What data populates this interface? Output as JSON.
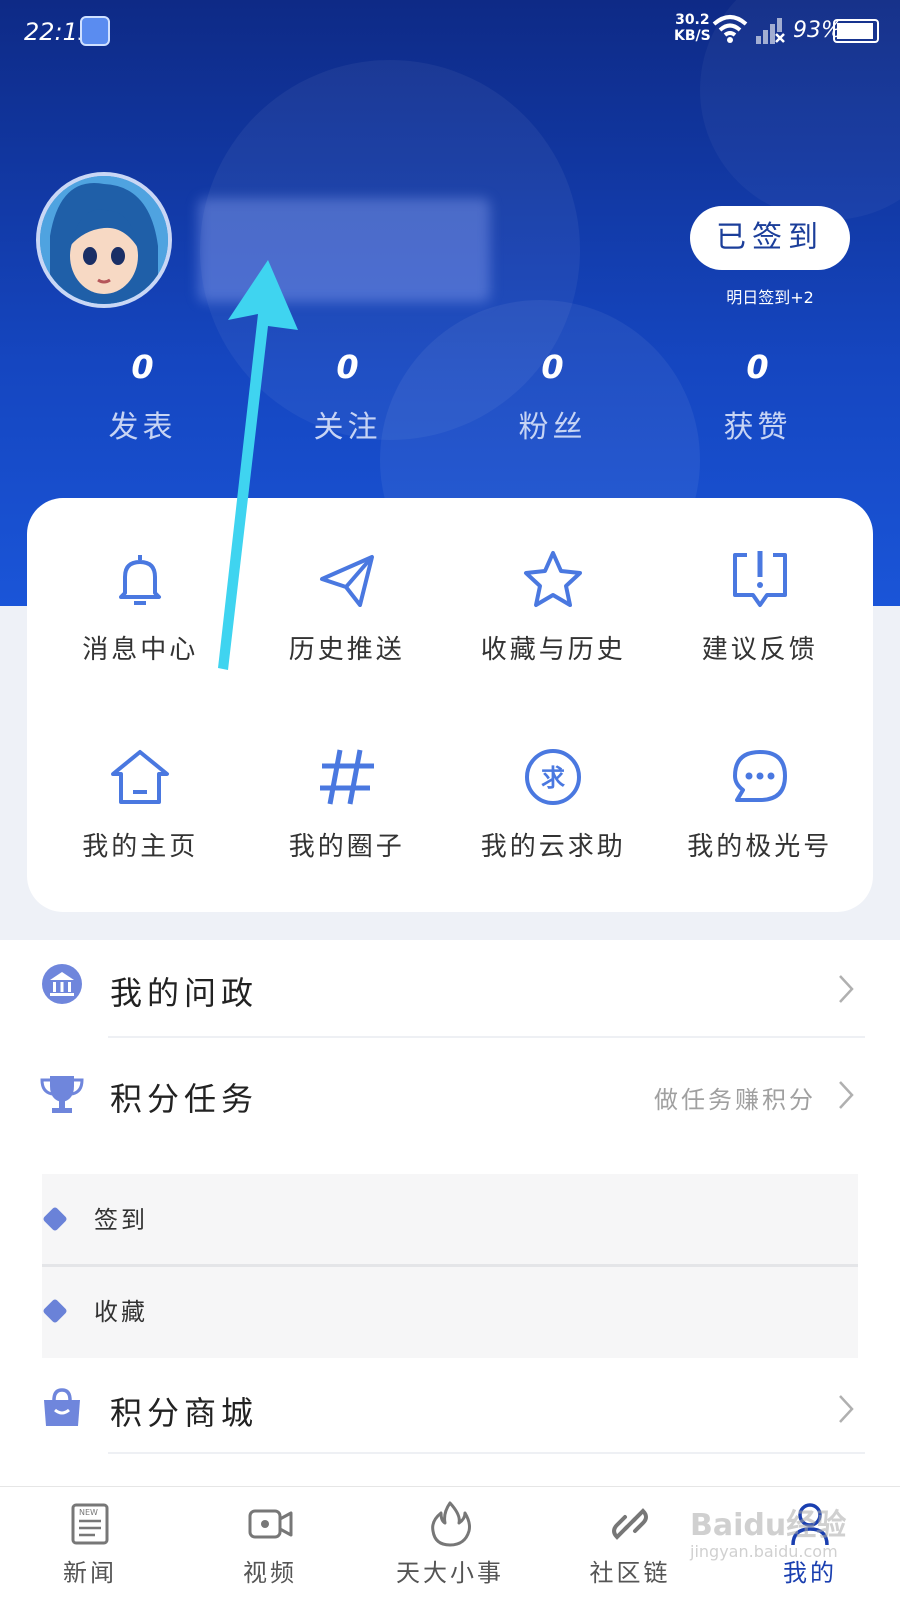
{
  "status_bar": {
    "time": "22:15",
    "net_speed_value": "30.2",
    "net_speed_unit": "KB/S",
    "battery": "93%"
  },
  "profile": {
    "checkin_label": "已签到",
    "checkin_hint": "明日签到+2"
  },
  "stats": [
    {
      "value": "0",
      "label": "发表"
    },
    {
      "value": "0",
      "label": "关注"
    },
    {
      "value": "0",
      "label": "粉丝"
    },
    {
      "value": "0",
      "label": "获赞"
    }
  ],
  "grid": [
    {
      "label": "消息中心",
      "icon": "bell-icon"
    },
    {
      "label": "历史推送",
      "icon": "paper-plane-icon"
    },
    {
      "label": "收藏与历史",
      "icon": "star-icon"
    },
    {
      "label": "建议反馈",
      "icon": "feedback-icon"
    },
    {
      "label": "我的主页",
      "icon": "home-icon"
    },
    {
      "label": "我的圈子",
      "icon": "hash-icon"
    },
    {
      "label": "我的云求助",
      "icon": "help-seal-icon"
    },
    {
      "label": "我的极光号",
      "icon": "chat-bubble-icon"
    }
  ],
  "grid_help_glyph": "求",
  "menu": {
    "wenzheng": {
      "title": "我的问政",
      "icon": "government-icon"
    },
    "points_task": {
      "title": "积分任务",
      "side": "做任务赚积分",
      "icon": "trophy-icon"
    },
    "tasks": [
      {
        "label": "签到"
      },
      {
        "label": "收藏"
      }
    ],
    "points_mall": {
      "title": "积分商城",
      "icon": "shopping-bag-icon"
    }
  },
  "tabbar": [
    {
      "label": "新闻",
      "icon": "news-icon"
    },
    {
      "label": "视频",
      "icon": "video-icon"
    },
    {
      "label": "天大小事",
      "icon": "flame-icon"
    },
    {
      "label": "社区链",
      "icon": "link-icon"
    },
    {
      "label": "我的",
      "icon": "person-icon",
      "active": true
    }
  ],
  "news_icon_text": "NEW",
  "watermark": {
    "brand": "Baidu经验",
    "url": "jingyan.baidu.com"
  },
  "colors": {
    "accent": "#4a78e0",
    "hero": "#1546c0",
    "arrow": "#3fd4f0"
  }
}
